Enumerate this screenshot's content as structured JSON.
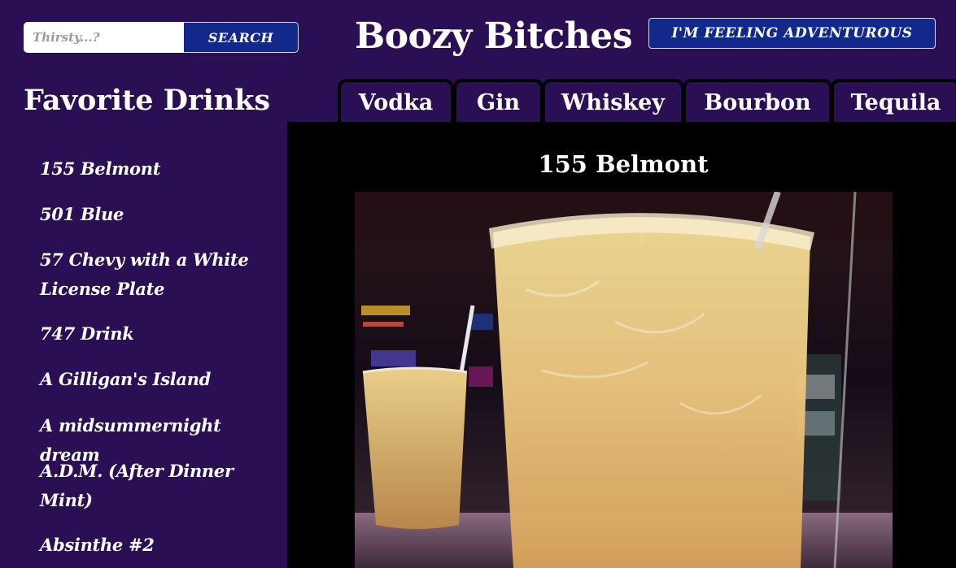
{
  "header": {
    "search_placeholder": "Thirsty...?",
    "search_button_label": "SEARCH",
    "site_title": "Boozy Bitches",
    "adventure_button_label": "I'M FEELING ADVENTUROUS"
  },
  "sidebar": {
    "heading": "Favorite Drinks",
    "items": [
      {
        "label": "155 Belmont"
      },
      {
        "label": "501 Blue"
      },
      {
        "label": "57 Chevy with a White License Plate"
      },
      {
        "label": "747 Drink"
      },
      {
        "label": "A Gilligan's Island"
      },
      {
        "label": "A midsummernight dream"
      },
      {
        "label": "A.D.M. (After Dinner Mint)"
      },
      {
        "label": "Absinthe #2"
      }
    ]
  },
  "tabs": [
    {
      "label": "Vodka"
    },
    {
      "label": "Gin"
    },
    {
      "label": "Whiskey"
    },
    {
      "label": "Bourbon"
    },
    {
      "label": "Tequila"
    }
  ],
  "main": {
    "drink_title": "155 Belmont"
  },
  "colors": {
    "background": "#2b0f55",
    "button_blue": "#12288a",
    "panel": "#000000",
    "text": "#ffffff"
  }
}
